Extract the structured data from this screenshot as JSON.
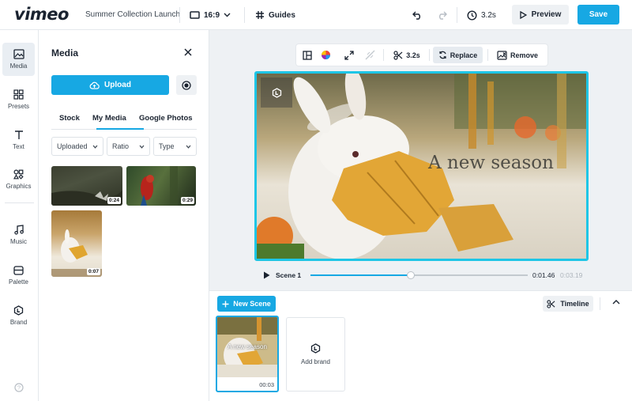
{
  "app": {
    "logo": "vimeo",
    "project_title": "Summer Collection Launch"
  },
  "topbar": {
    "aspect_ratio": "16:9",
    "guides_label": "Guides",
    "duration": "3.2s",
    "preview_label": "Preview",
    "save_label": "Save"
  },
  "rail": {
    "items": [
      {
        "label": "Media",
        "icon": "image-icon"
      },
      {
        "label": "Presets",
        "icon": "grid-icon"
      },
      {
        "label": "Text",
        "icon": "text-icon"
      },
      {
        "label": "Graphics",
        "icon": "shapes-icon"
      },
      {
        "label": "Music",
        "icon": "music-icon"
      },
      {
        "label": "Palette",
        "icon": "palette-icon"
      },
      {
        "label": "Brand",
        "icon": "brand-icon"
      }
    ],
    "help_icon": "help-icon"
  },
  "media_panel": {
    "title": "Media",
    "upload_label": "Upload",
    "tabs": [
      "Stock",
      "My Media",
      "Google Photos"
    ],
    "active_tab": "My Media",
    "filters": [
      "Uploaded",
      "Ratio",
      "Type"
    ],
    "thumbnails": [
      {
        "duration": "0:24"
      },
      {
        "duration": "0:29"
      },
      {
        "duration": "0:07"
      }
    ]
  },
  "canvas_toolbar": {
    "duration": "3.2s",
    "replace_label": "Replace",
    "remove_label": "Remove"
  },
  "canvas": {
    "overlay_text": "A new season"
  },
  "player": {
    "scene_label": "Scene 1",
    "current_time": "0:01.46",
    "total_time": "0:03.19",
    "progress": 0.46
  },
  "timeline": {
    "new_scene_label": "New Scene",
    "timeline_label": "Timeline",
    "scenes": [
      {
        "text": "A new season",
        "duration": "00:03"
      }
    ],
    "add_brand_label": "Add brand"
  },
  "colors": {
    "accent": "#17a8e3",
    "selection": "#1ec6e6"
  }
}
